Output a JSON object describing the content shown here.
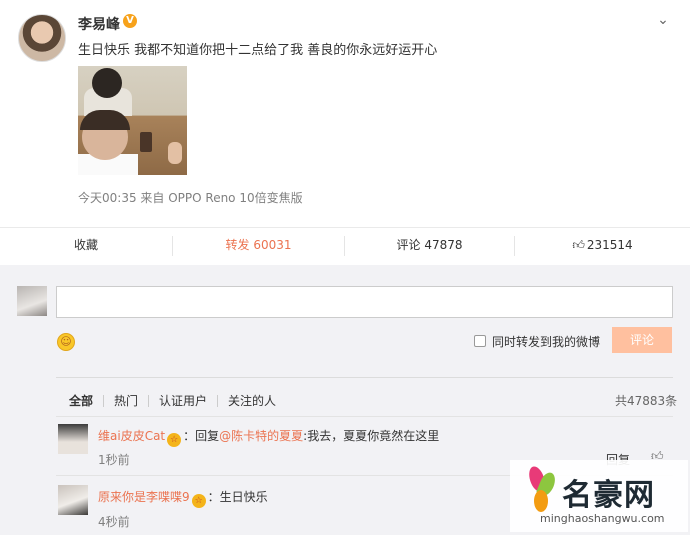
{
  "post": {
    "username": "李易峰",
    "verified_badge": "V",
    "menu_icon": "chevron-down-icon",
    "text": "生日快乐 我都不知道你把十二点给了我 善良的你永远好运开心",
    "meta": "今天00:35 来自 OPPO Reno 10倍变焦版"
  },
  "actions": {
    "favorite": "收藏",
    "repost": "转发 60031",
    "comment": "评论 47878",
    "like": "231514"
  },
  "composer": {
    "emoji_icon": "smile-icon",
    "repost_checkbox_label": "同时转发到我的微博",
    "submit_label": "评论"
  },
  "filters": {
    "all": "全部",
    "hot": "热门",
    "verified": "认证用户",
    "following": "关注的人",
    "total": "共47883条"
  },
  "comments": [
    {
      "user": "维ai皮皮Cat",
      "text": "：回复",
      "mention": "@陈卡特的夏夏",
      "text2": ":我去，夏夏你竟然在这里",
      "time": "1秒前",
      "reply_label": "回复"
    },
    {
      "user": "原来你是李喋喋9",
      "text": "：生日快乐",
      "time": "4秒前"
    }
  ],
  "watermark": {
    "brand": "名豪网",
    "url": "minghaoshangwu.com"
  },
  "colors": {
    "accent": "#eb7350",
    "submit_disabled": "#ffc09f",
    "panel_bg": "#f2f2f5"
  }
}
